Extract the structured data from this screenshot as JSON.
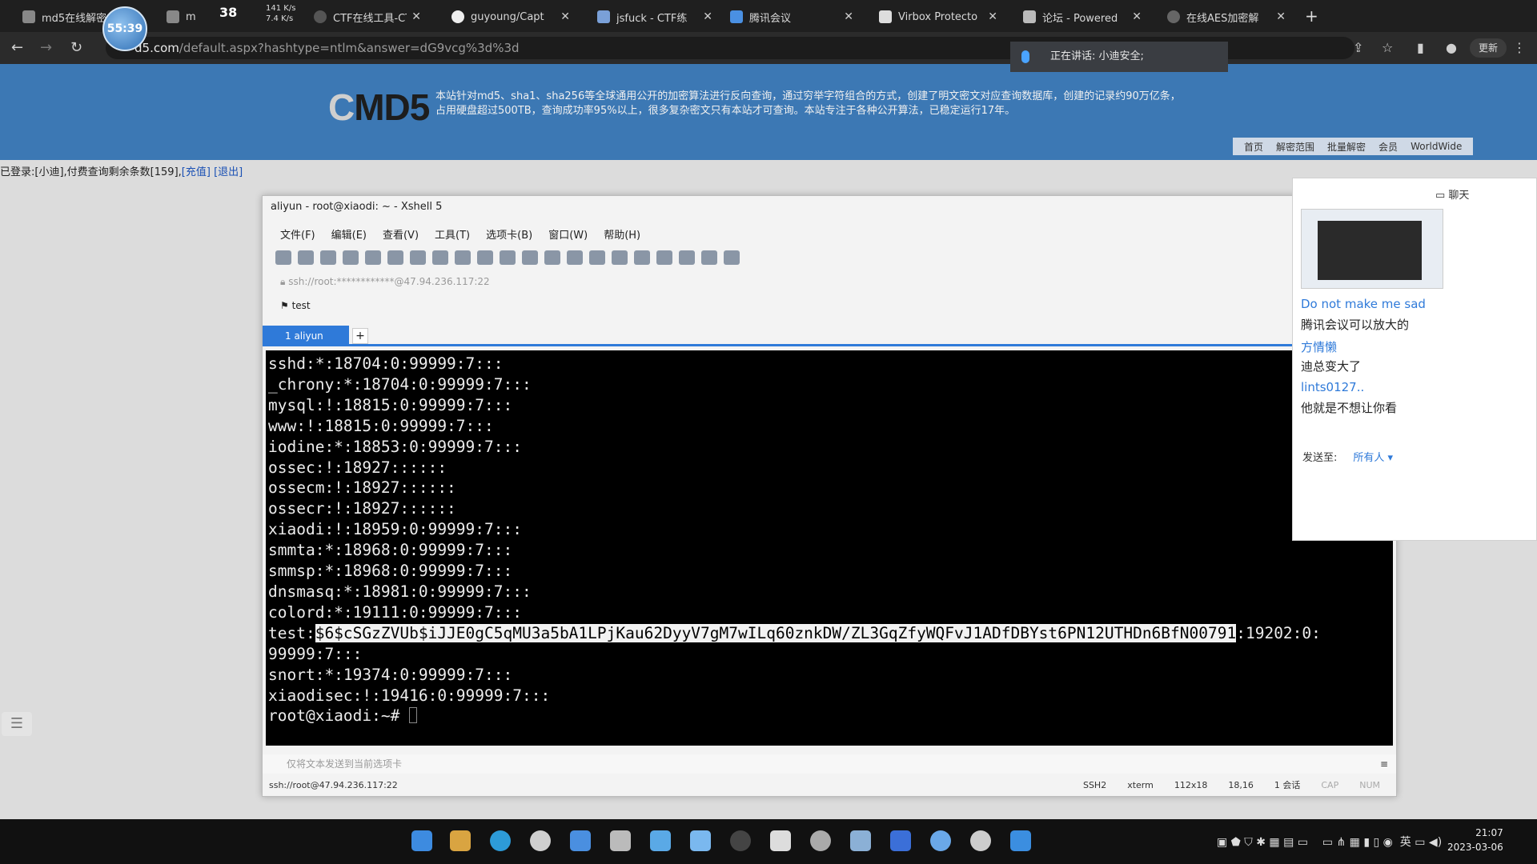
{
  "browser": {
    "timer": "55:39",
    "tab_count": "38",
    "net_speed_up": "141 K/s",
    "net_speed_down": "7.4 K/s",
    "tabs": [
      {
        "title": "md5在线解密"
      },
      {
        "title": "m"
      },
      {
        "title": "CTF在线工具-CT"
      },
      {
        "title": "guyoung/Capt"
      },
      {
        "title": "jsfuck - CTF练"
      },
      {
        "title": "腾讯会议"
      },
      {
        "title": "Virbox Protecto"
      },
      {
        "title": "论坛 - Powered"
      },
      {
        "title": "在线AES加密解"
      }
    ],
    "url_prefix": "d5.com",
    "url_rest": "/default.aspx?hashtype=ntlm&answer=dG9vcg%3d%3d",
    "meeting_status": "正在讲话: 小迪安全;",
    "update_label": "更新"
  },
  "page": {
    "logo_c": "C",
    "logo_rest": "MD5",
    "intro_line1": "本站针对md5、sha1、sha256等全球通用公开的加密算法进行反向查询，通过穷举字符组合的方式，创建了明文密文对应查询数据库，创建的记录约90万亿条，",
    "intro_line2": "占用硬盘超过500TB，查询成功率95%以上，很多复杂密文只有本站才可查询。本站专注于各种公开算法，已稳定运行17年。",
    "nav": [
      "首页",
      "解密范围",
      "批量解密",
      "会员",
      "WorldWide"
    ],
    "login_prefix": "已登录:[",
    "login_user": "小迪",
    "login_mid": "],付费查询剩余条数[",
    "login_count": "159",
    "login_suffix": "],",
    "recharge": "[充值]",
    "logout": "[退出]"
  },
  "xshell": {
    "title": "aliyun - root@xiaodi: ~ - Xshell 5",
    "menu": [
      "文件(F)",
      "编辑(E)",
      "查看(V)",
      "工具(T)",
      "选项卡(B)",
      "窗口(W)",
      "帮助(H)"
    ],
    "address": "ssh://root:************@47.94.236.117:22",
    "bookmark": "test",
    "tab_label": "1 aliyun",
    "terminal_lines": [
      "sshd:*:18704:0:99999:7:::",
      "_chrony:*:18704:0:99999:7:::",
      "mysql:!:18815:0:99999:7:::",
      "www:!:18815:0:99999:7:::",
      "iodine:*:18853:0:99999:7:::",
      "ossec:!:18927::::::",
      "ossecm:!:18927::::::",
      "ossecr:!:18927::::::",
      "xiaodi:!:18959:0:99999:7:::",
      "smmta:*:18968:0:99999:7:::",
      "smmsp:*:18968:0:99999:7:::",
      "dnsmasq:*:18981:0:99999:7:::",
      "colord:*:19111:0:99999:7:::"
    ],
    "test_prefix": "test:",
    "test_hash": "$6$cSGzZVUb$iJJE0gC5qMU3a5bA1LPjKau62DyyV7gM7wILq60znkDW/ZL3GqZfyWQFvJ1ADfDBYst6PN12UTHDn6BfN00791",
    "test_suffix": ":19202:0:",
    "test_wrap": "99999:7:::",
    "after_lines": [
      "snort:*:19374:0:99999:7:::",
      "xiaodisec:!:19416:0:99999:7:::"
    ],
    "prompt": "root@xiaodi:~# ",
    "send_bar": "仅将文本发送到当前选项卡",
    "status_addr": "ssh://root@47.94.236.117:22",
    "status_items": [
      "SSH2",
      "xterm",
      "112x18",
      "18,16",
      "1 会话",
      "CAP",
      "NUM"
    ]
  },
  "chat": {
    "header": "聊天",
    "messages": [
      {
        "name": "Do not make me sad",
        "text": "腾讯会议可以放大的"
      },
      {
        "name": "方情懒",
        "text": "迪总变大了"
      },
      {
        "name": "lints0127..",
        "text": "他就是不想让你看"
      }
    ],
    "send_to_label": "发送至:",
    "send_to_value": "所有人"
  },
  "taskbar": {
    "time": "21:07",
    "date": "2023-03-06",
    "ime": "英"
  }
}
